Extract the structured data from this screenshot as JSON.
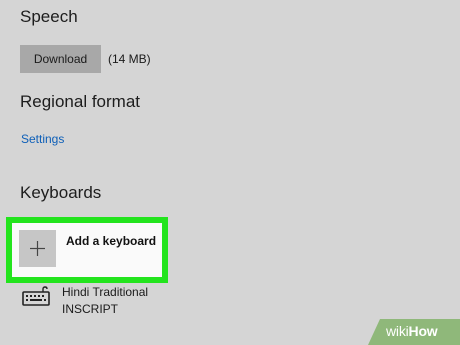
{
  "speech": {
    "title": "Speech",
    "download_label": "Download",
    "size": "(14 MB)"
  },
  "regional": {
    "title": "Regional format",
    "settings_link": "Settings"
  },
  "keyboards": {
    "title": "Keyboards",
    "add_label": "Add a keyboard",
    "items": [
      {
        "name": "Hindi Traditional",
        "layout": "INSCRIPT"
      }
    ]
  },
  "watermark": {
    "wiki": "wiki",
    "how": "How"
  },
  "colors": {
    "highlight": "#23e41d",
    "link": "#0d5fb8",
    "background": "#d5d5d5",
    "watermark": "#8fb87a"
  },
  "icons": {
    "add": "plus-icon",
    "keyboard": "keyboard-icon"
  }
}
